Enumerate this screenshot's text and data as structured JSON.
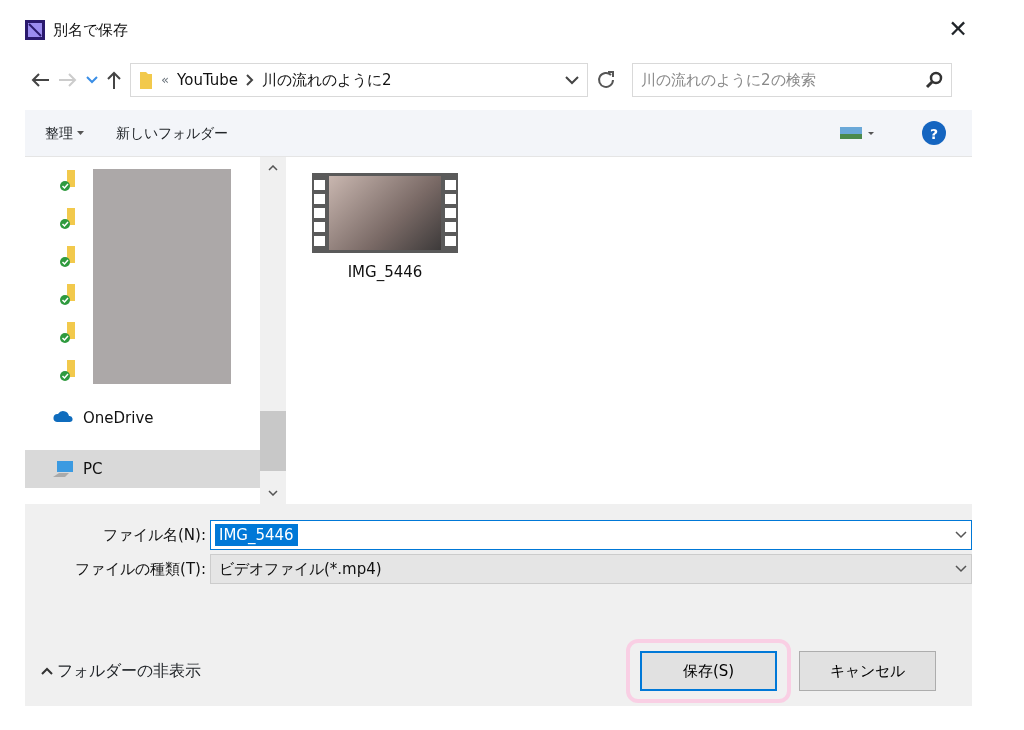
{
  "window": {
    "title": "別名で保存",
    "close": "✕"
  },
  "navigation": {
    "breadcrumb_overflow": "«",
    "path": [
      "YouTube",
      "川の流れのように2"
    ],
    "search": {
      "placeholder": "川の流れのように2の検索"
    },
    "back_enabled": true,
    "forward_enabled": false
  },
  "toolbar": {
    "organize": "整理",
    "new_folder": "新しいフォルダー",
    "help": "?"
  },
  "sidebar": {
    "folders": [
      {
        "synced": true
      },
      {
        "synced": true
      },
      {
        "synced": true
      },
      {
        "synced": true
      },
      {
        "synced": true
      },
      {
        "synced": true
      }
    ],
    "items": [
      {
        "kind": "cloud",
        "label": "OneDrive",
        "selected": false
      },
      {
        "kind": "pc",
        "label": "PC",
        "selected": true
      }
    ]
  },
  "files": [
    {
      "kind": "video",
      "name": "IMG_5446"
    }
  ],
  "form": {
    "filename_label": "ファイル名(N):",
    "filename_value": "IMG_5446",
    "type_label": "ファイルの種類(T):",
    "type_value": "ビデオファイル(*.mp4)"
  },
  "footer": {
    "hide_folders": "フォルダーの非表示",
    "save": "保存(S)",
    "cancel": "キャンセル",
    "save_highlighted": true
  }
}
